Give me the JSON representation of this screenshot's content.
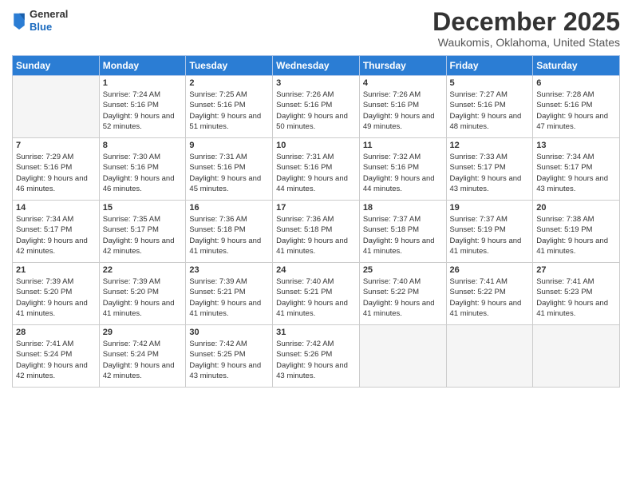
{
  "logo": {
    "general": "General",
    "blue": "Blue"
  },
  "header": {
    "month": "December 2025",
    "location": "Waukomis, Oklahoma, United States"
  },
  "weekdays": [
    "Sunday",
    "Monday",
    "Tuesday",
    "Wednesday",
    "Thursday",
    "Friday",
    "Saturday"
  ],
  "weeks": [
    [
      {
        "day": "",
        "sunrise": "",
        "sunset": "",
        "daylight": ""
      },
      {
        "day": "1",
        "sunrise": "Sunrise: 7:24 AM",
        "sunset": "Sunset: 5:16 PM",
        "daylight": "Daylight: 9 hours and 52 minutes."
      },
      {
        "day": "2",
        "sunrise": "Sunrise: 7:25 AM",
        "sunset": "Sunset: 5:16 PM",
        "daylight": "Daylight: 9 hours and 51 minutes."
      },
      {
        "day": "3",
        "sunrise": "Sunrise: 7:26 AM",
        "sunset": "Sunset: 5:16 PM",
        "daylight": "Daylight: 9 hours and 50 minutes."
      },
      {
        "day": "4",
        "sunrise": "Sunrise: 7:26 AM",
        "sunset": "Sunset: 5:16 PM",
        "daylight": "Daylight: 9 hours and 49 minutes."
      },
      {
        "day": "5",
        "sunrise": "Sunrise: 7:27 AM",
        "sunset": "Sunset: 5:16 PM",
        "daylight": "Daylight: 9 hours and 48 minutes."
      },
      {
        "day": "6",
        "sunrise": "Sunrise: 7:28 AM",
        "sunset": "Sunset: 5:16 PM",
        "daylight": "Daylight: 9 hours and 47 minutes."
      }
    ],
    [
      {
        "day": "7",
        "sunrise": "Sunrise: 7:29 AM",
        "sunset": "Sunset: 5:16 PM",
        "daylight": "Daylight: 9 hours and 46 minutes."
      },
      {
        "day": "8",
        "sunrise": "Sunrise: 7:30 AM",
        "sunset": "Sunset: 5:16 PM",
        "daylight": "Daylight: 9 hours and 46 minutes."
      },
      {
        "day": "9",
        "sunrise": "Sunrise: 7:31 AM",
        "sunset": "Sunset: 5:16 PM",
        "daylight": "Daylight: 9 hours and 45 minutes."
      },
      {
        "day": "10",
        "sunrise": "Sunrise: 7:31 AM",
        "sunset": "Sunset: 5:16 PM",
        "daylight": "Daylight: 9 hours and 44 minutes."
      },
      {
        "day": "11",
        "sunrise": "Sunrise: 7:32 AM",
        "sunset": "Sunset: 5:16 PM",
        "daylight": "Daylight: 9 hours and 44 minutes."
      },
      {
        "day": "12",
        "sunrise": "Sunrise: 7:33 AM",
        "sunset": "Sunset: 5:17 PM",
        "daylight": "Daylight: 9 hours and 43 minutes."
      },
      {
        "day": "13",
        "sunrise": "Sunrise: 7:34 AM",
        "sunset": "Sunset: 5:17 PM",
        "daylight": "Daylight: 9 hours and 43 minutes."
      }
    ],
    [
      {
        "day": "14",
        "sunrise": "Sunrise: 7:34 AM",
        "sunset": "Sunset: 5:17 PM",
        "daylight": "Daylight: 9 hours and 42 minutes."
      },
      {
        "day": "15",
        "sunrise": "Sunrise: 7:35 AM",
        "sunset": "Sunset: 5:17 PM",
        "daylight": "Daylight: 9 hours and 42 minutes."
      },
      {
        "day": "16",
        "sunrise": "Sunrise: 7:36 AM",
        "sunset": "Sunset: 5:18 PM",
        "daylight": "Daylight: 9 hours and 41 minutes."
      },
      {
        "day": "17",
        "sunrise": "Sunrise: 7:36 AM",
        "sunset": "Sunset: 5:18 PM",
        "daylight": "Daylight: 9 hours and 41 minutes."
      },
      {
        "day": "18",
        "sunrise": "Sunrise: 7:37 AM",
        "sunset": "Sunset: 5:18 PM",
        "daylight": "Daylight: 9 hours and 41 minutes."
      },
      {
        "day": "19",
        "sunrise": "Sunrise: 7:37 AM",
        "sunset": "Sunset: 5:19 PM",
        "daylight": "Daylight: 9 hours and 41 minutes."
      },
      {
        "day": "20",
        "sunrise": "Sunrise: 7:38 AM",
        "sunset": "Sunset: 5:19 PM",
        "daylight": "Daylight: 9 hours and 41 minutes."
      }
    ],
    [
      {
        "day": "21",
        "sunrise": "Sunrise: 7:39 AM",
        "sunset": "Sunset: 5:20 PM",
        "daylight": "Daylight: 9 hours and 41 minutes."
      },
      {
        "day": "22",
        "sunrise": "Sunrise: 7:39 AM",
        "sunset": "Sunset: 5:20 PM",
        "daylight": "Daylight: 9 hours and 41 minutes."
      },
      {
        "day": "23",
        "sunrise": "Sunrise: 7:39 AM",
        "sunset": "Sunset: 5:21 PM",
        "daylight": "Daylight: 9 hours and 41 minutes."
      },
      {
        "day": "24",
        "sunrise": "Sunrise: 7:40 AM",
        "sunset": "Sunset: 5:21 PM",
        "daylight": "Daylight: 9 hours and 41 minutes."
      },
      {
        "day": "25",
        "sunrise": "Sunrise: 7:40 AM",
        "sunset": "Sunset: 5:22 PM",
        "daylight": "Daylight: 9 hours and 41 minutes."
      },
      {
        "day": "26",
        "sunrise": "Sunrise: 7:41 AM",
        "sunset": "Sunset: 5:22 PM",
        "daylight": "Daylight: 9 hours and 41 minutes."
      },
      {
        "day": "27",
        "sunrise": "Sunrise: 7:41 AM",
        "sunset": "Sunset: 5:23 PM",
        "daylight": "Daylight: 9 hours and 41 minutes."
      }
    ],
    [
      {
        "day": "28",
        "sunrise": "Sunrise: 7:41 AM",
        "sunset": "Sunset: 5:24 PM",
        "daylight": "Daylight: 9 hours and 42 minutes."
      },
      {
        "day": "29",
        "sunrise": "Sunrise: 7:42 AM",
        "sunset": "Sunset: 5:24 PM",
        "daylight": "Daylight: 9 hours and 42 minutes."
      },
      {
        "day": "30",
        "sunrise": "Sunrise: 7:42 AM",
        "sunset": "Sunset: 5:25 PM",
        "daylight": "Daylight: 9 hours and 43 minutes."
      },
      {
        "day": "31",
        "sunrise": "Sunrise: 7:42 AM",
        "sunset": "Sunset: 5:26 PM",
        "daylight": "Daylight: 9 hours and 43 minutes."
      },
      {
        "day": "",
        "sunrise": "",
        "sunset": "",
        "daylight": ""
      },
      {
        "day": "",
        "sunrise": "",
        "sunset": "",
        "daylight": ""
      },
      {
        "day": "",
        "sunrise": "",
        "sunset": "",
        "daylight": ""
      }
    ]
  ]
}
